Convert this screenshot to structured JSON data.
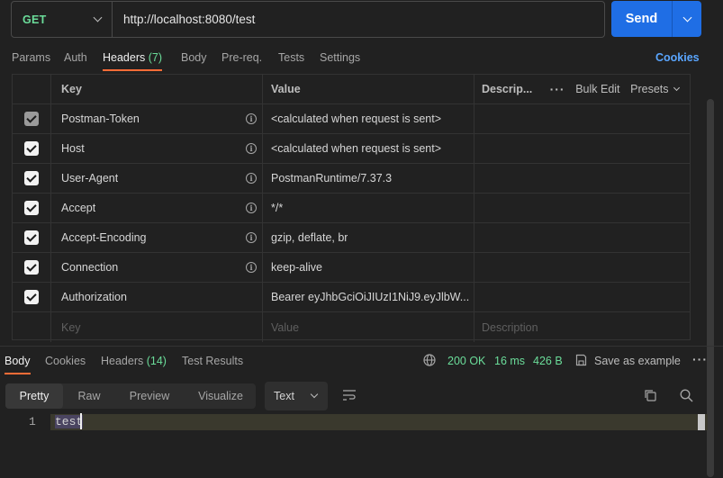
{
  "request": {
    "method": "GET",
    "url": "http://localhost:8080/test",
    "send_label": "Send"
  },
  "request_tabs": {
    "params": "Params",
    "auth": "Auth",
    "headers": "Headers",
    "headers_count": "(7)",
    "body": "Body",
    "prereq": "Pre-req.",
    "tests": "Tests",
    "settings": "Settings",
    "cookies": "Cookies"
  },
  "headers_table": {
    "col_key": "Key",
    "col_value": "Value",
    "col_desc": "Descrip...",
    "bulk_edit": "Bulk Edit",
    "presets": "Presets",
    "rows": [
      {
        "key": "Postman-Token",
        "value": "<calculated when request is sent>",
        "checked": true
      },
      {
        "key": "Host",
        "value": "<calculated when request is sent>",
        "checked": true
      },
      {
        "key": "User-Agent",
        "value": "PostmanRuntime/7.37.3",
        "checked": true
      },
      {
        "key": "Accept",
        "value": "*/*",
        "checked": true
      },
      {
        "key": "Accept-Encoding",
        "value": "gzip, deflate, br",
        "checked": true
      },
      {
        "key": "Connection",
        "value": "keep-alive",
        "checked": true
      },
      {
        "key": "Authorization",
        "value": "Bearer eyJhbGciOiJIUzI1NiJ9.eyJlbW...",
        "checked": true
      }
    ],
    "placeholder_key": "Key",
    "placeholder_value": "Value",
    "placeholder_desc": "Description"
  },
  "response_tabs": {
    "body": "Body",
    "cookies": "Cookies",
    "headers": "Headers",
    "headers_count": "(14)",
    "test_results": "Test Results"
  },
  "response_meta": {
    "status": "200 OK",
    "time": "16 ms",
    "size": "426 B",
    "save_example": "Save as example"
  },
  "view_tabs": [
    "Pretty",
    "Raw",
    "Preview",
    "Visualize"
  ],
  "format": "Text",
  "editor": {
    "line_number": "1",
    "content": "test"
  },
  "colors": {
    "accent": "#ff6c37",
    "send": "#1f6ee5",
    "ok": "#6bdd9a",
    "link": "#5aa6ff"
  }
}
